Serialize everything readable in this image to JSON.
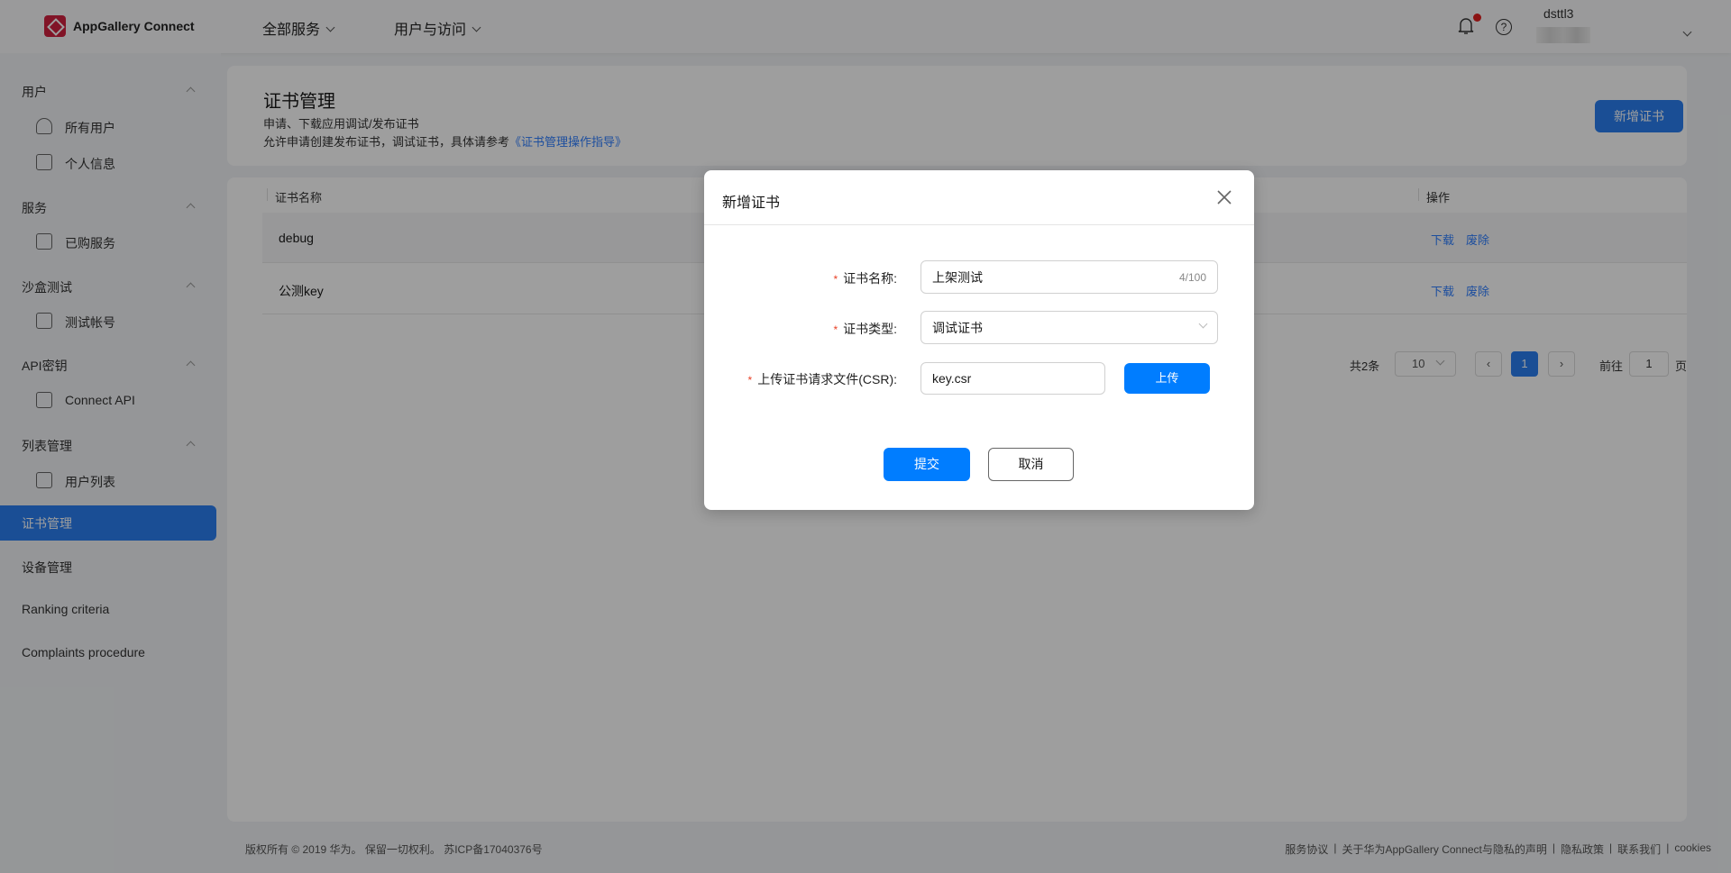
{
  "header": {
    "brand": "AppGallery Connect",
    "nav": [
      "全部服务",
      "用户与访问"
    ],
    "username": "dsttl3",
    "notification_dot_color": "#e02020",
    "icons": [
      "bell-icon",
      "help-icon",
      "chevron-down-icon"
    ]
  },
  "sidebar": {
    "groups": [
      {
        "label": "用户",
        "items": [
          {
            "label": "所有用户",
            "icon": "all-users-icon"
          },
          {
            "label": "个人信息",
            "icon": "profile-icon"
          }
        ]
      },
      {
        "label": "服务",
        "items": [
          {
            "label": "已购服务",
            "icon": "bag-icon"
          }
        ]
      },
      {
        "label": "沙盒测试",
        "items": [
          {
            "label": "测试帐号",
            "icon": "cube-icon"
          }
        ]
      },
      {
        "label": "API密钥",
        "items": [
          {
            "label": "Connect API",
            "icon": "api-icon"
          }
        ]
      },
      {
        "label": "列表管理",
        "items": [
          {
            "label": "用户列表",
            "icon": "list-icon"
          }
        ]
      }
    ],
    "top_items": [
      "证书管理",
      "设备管理",
      "Ranking criteria",
      "Complaints procedure"
    ],
    "active": "证书管理"
  },
  "page": {
    "title": "证书管理",
    "desc1": "申请、下载应用调试/发布证书",
    "desc2": "允许申请创建发布证书，调试证书，具体请参考",
    "guide_link": "《证书管理操作指导》",
    "add_button": "新增证书"
  },
  "table": {
    "columns": [
      "证书名称",
      "操作"
    ],
    "rows": [
      {
        "name": "debug",
        "actions": [
          "下载",
          "废除"
        ]
      },
      {
        "name": "公测key",
        "actions": [
          "下载",
          "废除"
        ]
      }
    ]
  },
  "pagination": {
    "total": "共2条",
    "page_size": "10",
    "current": "1",
    "goto_label": "前往",
    "goto_value": "1",
    "page_suffix": "页"
  },
  "footer": {
    "copyright": "版权所有 © 2019 华为。 保留一切权利。 苏ICP备17040376号",
    "links": [
      "服务协议",
      "关于华为AppGallery Connect与隐私的声明",
      "隐私政策",
      "联系我们",
      "cookies"
    ]
  },
  "dialog": {
    "title": "新增证书",
    "fields": {
      "name_label": "证书名称:",
      "name_value": "上架测试",
      "name_count": "4/100",
      "type_label": "证书类型:",
      "type_value": "调试证书",
      "csr_label": "上传证书请求文件(CSR):",
      "csr_value": "key.csr",
      "upload_button": "上传"
    },
    "submit": "提交",
    "cancel": "取消",
    "required_mark": "*"
  },
  "colors": {
    "accent": "#007dff",
    "active_sidebar": "#2a7ff0"
  }
}
